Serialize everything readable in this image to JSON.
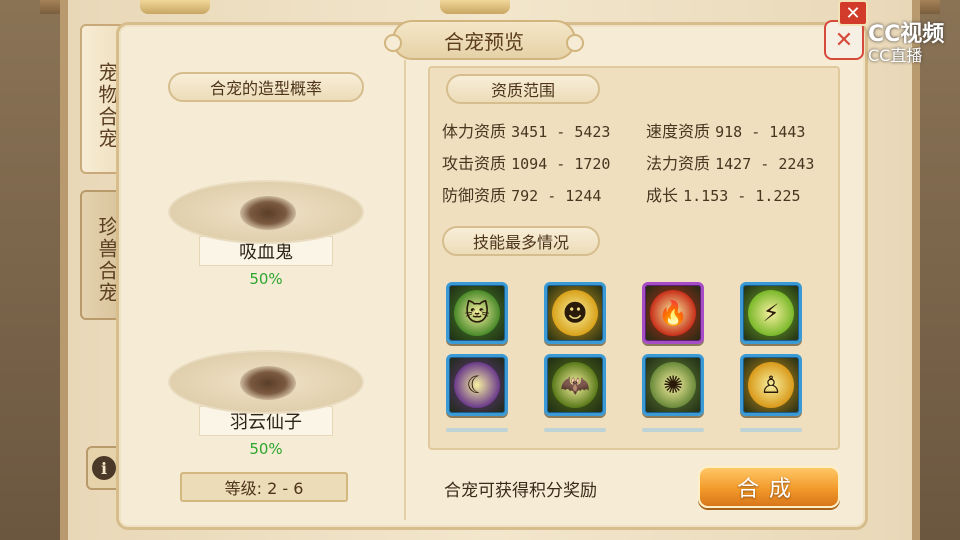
{
  "side_tabs": [
    {
      "label": "宠物合宠",
      "active": true
    },
    {
      "label": "珍兽合宠",
      "active": false
    }
  ],
  "info_label": "i",
  "dialog": {
    "title": "合宠预览",
    "close_label": "✕"
  },
  "left": {
    "section_title": "合宠的造型概率",
    "pets": [
      {
        "name": "吸血鬼",
        "probability": "50%"
      },
      {
        "name": "羽云仙子",
        "probability": "50%"
      }
    ],
    "level": "等级: 2 - 6"
  },
  "right": {
    "aptitude_title": "资质范围",
    "stats": [
      {
        "label": "体力资质",
        "value": "3451 - 5423"
      },
      {
        "label": "速度资质",
        "value": "918 - 1443"
      },
      {
        "label": "攻击资质",
        "value": "1094 - 1720"
      },
      {
        "label": "法力资质",
        "value": "1427 - 2243"
      },
      {
        "label": "防御资质",
        "value": "792 - 1244"
      },
      {
        "label": "成长",
        "value": "1.153 - 1.225"
      }
    ],
    "skills_title": "技能最多情况",
    "skills": [
      {
        "icon": "cat-warrior-icon",
        "glyph": "🐱",
        "color": "#4a8a2a",
        "frame": "blue"
      },
      {
        "icon": "fire-spirit-icon",
        "glyph": "☻",
        "color": "#d9a21a",
        "frame": "blue"
      },
      {
        "icon": "phoenix-icon",
        "glyph": "🔥",
        "color": "#c8301a",
        "frame": "purple"
      },
      {
        "icon": "lightning-strike-icon",
        "glyph": "⚡",
        "color": "#7ab82a",
        "frame": "blue"
      },
      {
        "icon": "crescent-moon-icon",
        "glyph": "☾",
        "color": "#6a3a8a",
        "frame": "blue"
      },
      {
        "icon": "bat-icon",
        "glyph": "🦇",
        "color": "#5a7a1a",
        "frame": "blue"
      },
      {
        "icon": "energy-burst-icon",
        "glyph": "✺",
        "color": "#6a8a3a",
        "frame": "blue"
      },
      {
        "icon": "golden-monk-icon",
        "glyph": "♙",
        "color": "#d99a1a",
        "frame": "blue"
      }
    ],
    "reward_text": "合宠可获得积分奖励",
    "merge_button": "合成"
  },
  "watermark": {
    "line1": "CC视频",
    "line2": "CC直播"
  }
}
